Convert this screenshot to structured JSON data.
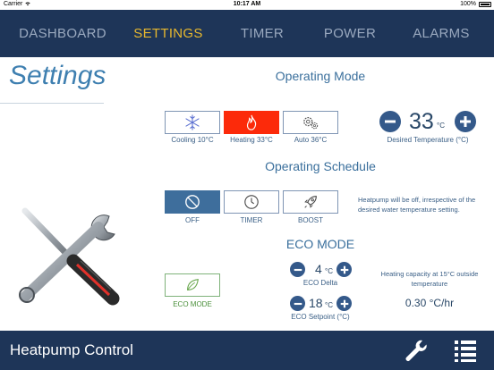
{
  "status_bar": {
    "carrier": "Carrier",
    "time": "10:17 AM",
    "battery": "100%"
  },
  "nav": {
    "tabs": [
      {
        "label": "DASHBOARD",
        "active": false
      },
      {
        "label": "SETTINGS",
        "active": true
      },
      {
        "label": "TIMER",
        "active": false
      },
      {
        "label": "POWER",
        "active": false
      },
      {
        "label": "ALARMS",
        "active": false
      }
    ]
  },
  "page": {
    "title": "Settings"
  },
  "operating_mode": {
    "title": "Operating Mode",
    "modes": [
      {
        "label": "Cooling 10°C",
        "icon": "snowflake-icon",
        "selected": false
      },
      {
        "label": "Heating 33°C",
        "icon": "flame-icon",
        "selected": true
      },
      {
        "label": "Auto 36°C",
        "icon": "gears-icon",
        "selected": false
      }
    ],
    "desired_temperature": {
      "value": "33",
      "unit": "°C",
      "caption": "Desired Temperature (°C)"
    }
  },
  "operating_schedule": {
    "title": "Operating Schedule",
    "options": [
      {
        "label": "OFF",
        "icon": "block-icon",
        "selected": true
      },
      {
        "label": "TIMER",
        "icon": "clock-icon",
        "selected": false
      },
      {
        "label": "BOOST",
        "icon": "rocket-icon",
        "selected": false
      }
    ],
    "info": "Heatpump will be off, irrespective of the desired water temperature setting."
  },
  "eco_mode": {
    "title": "ECO MODE",
    "button_label": "ECO MODE",
    "eco_delta": {
      "value": "4",
      "unit": "°C",
      "caption": "ECO Delta"
    },
    "eco_setpoint": {
      "value": "18",
      "unit": "°C",
      "caption": "ECO Setpoint (°C)"
    },
    "capacity": {
      "caption": "Heating capacity at 15°C outside temperature",
      "value": "0.30 °C/hr"
    }
  },
  "footer": {
    "title": "Heatpump Control"
  },
  "colors": {
    "nav_bg": "#1e3558",
    "active_tab": "#e8b82e",
    "heating_red": "#fc2a0a",
    "accent_blue": "#3e6e9c",
    "eco_green": "#6aa84f"
  }
}
